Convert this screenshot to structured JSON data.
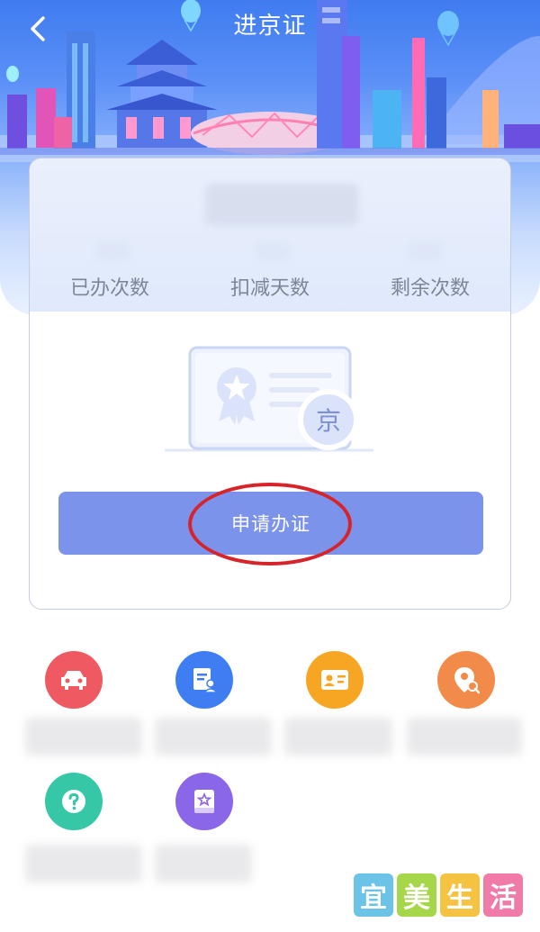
{
  "header": {
    "title": "进京证"
  },
  "stats": {
    "issued_label": "已办次数",
    "deducted_label": "扣减天数",
    "remaining_label": "剩余次数"
  },
  "badge": {
    "text": "京"
  },
  "apply": {
    "label": "申请办证"
  },
  "services": [
    {
      "icon": "car-icon",
      "color": "#ef5a62"
    },
    {
      "icon": "form-user-icon",
      "color": "#3f7ef2"
    },
    {
      "icon": "id-card-icon",
      "color": "#f6a623"
    },
    {
      "icon": "location-search-icon",
      "color": "#f28a4a"
    },
    {
      "icon": "help-icon",
      "color": "#35c7a6"
    },
    {
      "icon": "guide-book-icon",
      "color": "#8a66e8"
    }
  ],
  "watermark": {
    "chars": [
      "宜",
      "美",
      "生",
      "活"
    ]
  },
  "colors": {
    "primary": "#7b93ea",
    "highlight": "#d7242a",
    "stat_text": "#7d8596"
  }
}
